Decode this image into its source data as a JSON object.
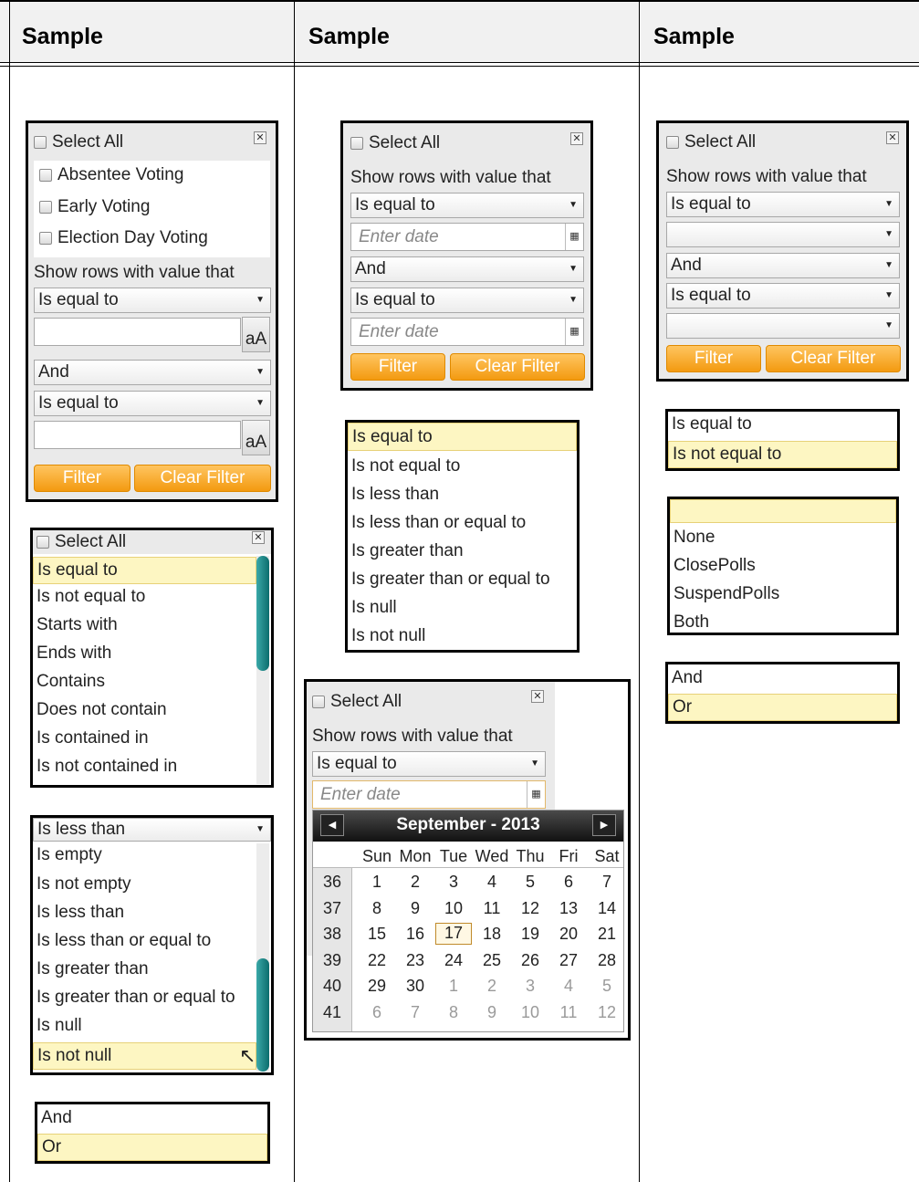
{
  "headers": [
    "Sample",
    "Sample",
    "Sample"
  ],
  "col1": {
    "panel": {
      "select_all": "Select All",
      "options": [
        "Absentee Voting",
        "Early Voting",
        "Election Day Voting"
      ],
      "show_rows": "Show rows with value that",
      "op1": "Is equal to",
      "case_btn": "aA",
      "logic": "And",
      "op2": "Is equal to",
      "filter": "Filter",
      "clear": "Clear Filter"
    },
    "list_header": "Select All",
    "string_ops": [
      "Is equal to",
      "Is not equal to",
      "Starts with",
      "Ends with",
      "Contains",
      "Does not contain",
      "Is contained in",
      "Is not contained in"
    ],
    "dropdown_selected": "Is less than",
    "more_ops": [
      "Is empty",
      "Is not empty",
      "Is less than",
      "Is less than or equal to",
      "Is greater than",
      "Is greater than or equal to",
      "Is null",
      "Is not null"
    ],
    "logic_ops": [
      "And",
      "Or"
    ]
  },
  "col2": {
    "panel": {
      "select_all": "Select All",
      "show_rows": "Show rows with value that",
      "op1": "Is equal to",
      "date_placeholder": "Enter date",
      "logic": "And",
      "op2": "Is equal to",
      "filter": "Filter",
      "clear": "Clear Filter"
    },
    "date_ops": [
      "Is equal to",
      "Is not equal to",
      "Is less than",
      "Is less than or equal to",
      "Is greater than",
      "Is greater than or equal to",
      "Is null",
      "Is not null"
    ],
    "calendar_panel": {
      "select_all": "Select All",
      "show_rows": "Show rows with value that",
      "op1": "Is equal to",
      "date_placeholder": "Enter date"
    },
    "calendar": {
      "title": "September - 2013",
      "days": [
        "Sun",
        "Mon",
        "Tue",
        "Wed",
        "Thu",
        "Fri",
        "Sat"
      ],
      "weeks": [
        "36",
        "37",
        "38",
        "39",
        "40",
        "41"
      ],
      "dates": [
        [
          "1",
          "2",
          "3",
          "4",
          "5",
          "6",
          "7"
        ],
        [
          "8",
          "9",
          "10",
          "11",
          "12",
          "13",
          "14"
        ],
        [
          "15",
          "16",
          "17",
          "18",
          "19",
          "20",
          "21"
        ],
        [
          "22",
          "23",
          "24",
          "25",
          "26",
          "27",
          "28"
        ],
        [
          "29",
          "30",
          "1",
          "2",
          "3",
          "4",
          "5"
        ],
        [
          "6",
          "7",
          "8",
          "9",
          "10",
          "11",
          "12"
        ]
      ],
      "today": "17"
    }
  },
  "col3": {
    "panel": {
      "select_all": "Select All",
      "show_rows": "Show rows with value that",
      "op1": "Is equal to",
      "logic": "And",
      "op2": "Is equal to",
      "filter": "Filter",
      "clear": "Clear Filter"
    },
    "bool_ops": [
      "Is equal to",
      "Is not equal to"
    ],
    "enum_values": [
      "None",
      "ClosePolls",
      "SuspendPolls",
      "Both"
    ],
    "logic_ops": [
      "And",
      "Or"
    ]
  }
}
